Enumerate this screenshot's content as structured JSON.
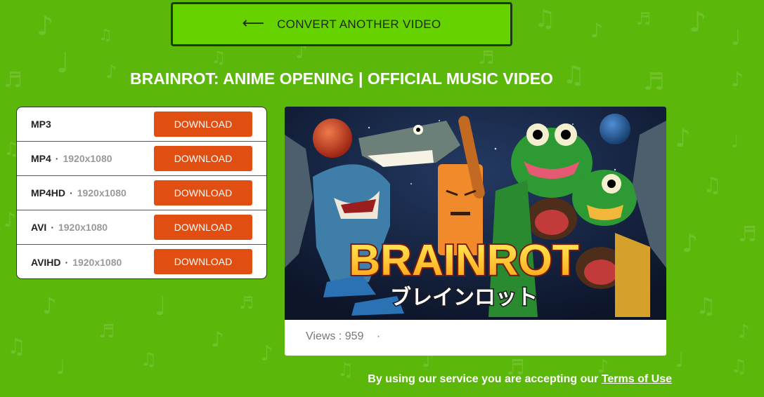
{
  "convert_button": {
    "label": "CONVERT ANOTHER VIDEO",
    "icon": "arrow-left-icon"
  },
  "title": "BRAINROT: ANIME OPENING | OFFICIAL MUSIC VIDEO",
  "formats": [
    {
      "name": "MP3",
      "resolution": "",
      "button": "DOWNLOAD"
    },
    {
      "name": "MP4",
      "resolution": "1920x1080",
      "button": "DOWNLOAD"
    },
    {
      "name": "MP4HD",
      "resolution": "1920x1080",
      "button": "DOWNLOAD"
    },
    {
      "name": "AVI",
      "resolution": "1920x1080",
      "button": "DOWNLOAD"
    },
    {
      "name": "AVIHD",
      "resolution": "1920x1080",
      "button": "DOWNLOAD"
    }
  ],
  "video": {
    "thumbnail_title": "BRAINROT",
    "thumbnail_subtitle": "ブレインロット",
    "views_label": "Views : 959",
    "views_separator": "·"
  },
  "footer": {
    "text": "By using our service you are accepting our ",
    "link": "Terms of Use"
  },
  "colors": {
    "background": "#5bb80b",
    "convert_button": "#66d200",
    "download_button": "#e04e12"
  }
}
